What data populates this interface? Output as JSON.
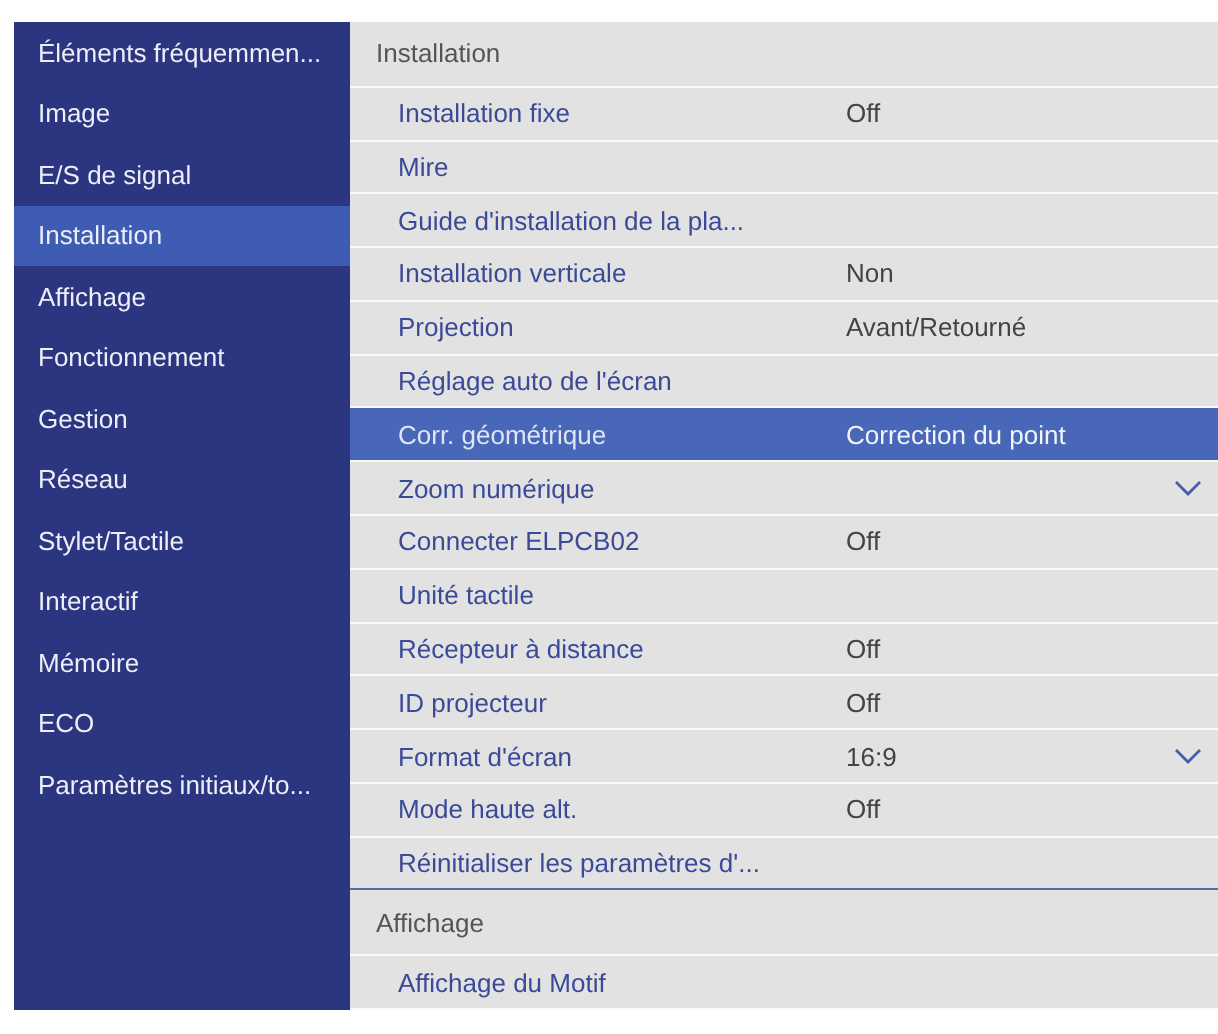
{
  "sidebar": {
    "items": [
      {
        "label": "Éléments fréquemmen...",
        "selected": false
      },
      {
        "label": "Image",
        "selected": false
      },
      {
        "label": "E/S de signal",
        "selected": false
      },
      {
        "label": "Installation",
        "selected": true
      },
      {
        "label": "Affichage",
        "selected": false
      },
      {
        "label": "Fonctionnement",
        "selected": false
      },
      {
        "label": "Gestion",
        "selected": false
      },
      {
        "label": "Réseau",
        "selected": false
      },
      {
        "label": "Stylet/Tactile",
        "selected": false
      },
      {
        "label": "Interactif",
        "selected": false
      },
      {
        "label": "Mémoire",
        "selected": false
      },
      {
        "label": "ECO",
        "selected": false
      },
      {
        "label": "Paramètres initiaux/to...",
        "selected": false
      }
    ]
  },
  "sections": [
    {
      "title": "Installation",
      "items": [
        {
          "label": "Installation fixe",
          "value": "Off",
          "selected": false,
          "dropdown": false
        },
        {
          "label": "Mire",
          "selected": false,
          "dropdown": false
        },
        {
          "label": "Guide d'installation de la pla...",
          "selected": false,
          "dropdown": false
        },
        {
          "label": "Installation verticale",
          "value": "Non",
          "selected": false,
          "dropdown": false
        },
        {
          "label": "Projection",
          "value": "Avant/Retourné",
          "selected": false,
          "dropdown": false
        },
        {
          "label": "Réglage auto de l'écran",
          "selected": false,
          "dropdown": false
        },
        {
          "label": "Corr. géométrique",
          "value": "Correction du point",
          "selected": true,
          "dropdown": false
        },
        {
          "label": "Zoom numérique",
          "selected": false,
          "dropdown": true
        },
        {
          "label": "Connecter ELPCB02",
          "value": "Off",
          "selected": false,
          "dropdown": false
        },
        {
          "label": "Unité tactile",
          "selected": false,
          "dropdown": false
        },
        {
          "label": "Récepteur à distance",
          "value": "Off",
          "selected": false,
          "dropdown": false
        },
        {
          "label": "ID projecteur",
          "value": "Off",
          "selected": false,
          "dropdown": false
        },
        {
          "label": "Format d'écran",
          "value": "16:9",
          "selected": false,
          "dropdown": true
        },
        {
          "label": "Mode haute alt.",
          "value": "Off",
          "selected": false,
          "dropdown": false
        },
        {
          "label": "Réinitialiser les paramètres d'...",
          "selected": false,
          "dropdown": false
        }
      ]
    },
    {
      "title": "Affichage",
      "items": [
        {
          "label": "Affichage du Motif",
          "selected": false,
          "dropdown": false
        }
      ]
    }
  ]
}
